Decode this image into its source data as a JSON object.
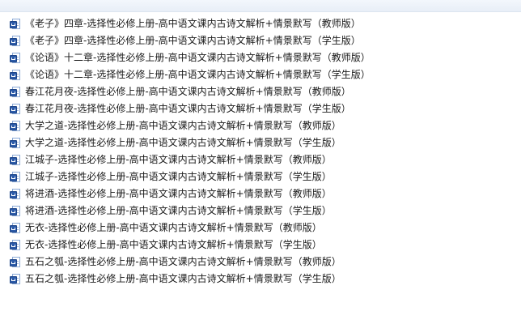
{
  "files": [
    {
      "name": "《老子》四章-选择性必修上册-高中语文课内古诗文解析+情景默写（教师版）",
      "icon": "word-doc-icon"
    },
    {
      "name": "《老子》四章-选择性必修上册-高中语文课内古诗文解析+情景默写（学生版）",
      "icon": "word-doc-icon"
    },
    {
      "name": "《论语》十二章-选择性必修上册-高中语文课内古诗文解析+情景默写（教师版）",
      "icon": "word-doc-icon"
    },
    {
      "name": "《论语》十二章-选择性必修上册-高中语文课内古诗文解析+情景默写（学生版）",
      "icon": "word-doc-icon"
    },
    {
      "name": "春江花月夜-选择性必修上册-高中语文课内古诗文解析+情景默写（教师版）",
      "icon": "word-doc-icon"
    },
    {
      "name": "春江花月夜-选择性必修上册-高中语文课内古诗文解析+情景默写（学生版）",
      "icon": "word-doc-icon"
    },
    {
      "name": "大学之道-选择性必修上册-高中语文课内古诗文解析+情景默写（教师版）",
      "icon": "word-doc-icon"
    },
    {
      "name": "大学之道-选择性必修上册-高中语文课内古诗文解析+情景默写（学生版）",
      "icon": "word-doc-icon"
    },
    {
      "name": "江城子-选择性必修上册-高中语文课内古诗文解析+情景默写（教师版）",
      "icon": "word-doc-icon"
    },
    {
      "name": "江城子-选择性必修上册-高中语文课内古诗文解析+情景默写（学生版）",
      "icon": "word-doc-icon"
    },
    {
      "name": "将进酒-选择性必修上册-高中语文课内古诗文解析+情景默写（教师版）",
      "icon": "word-doc-icon"
    },
    {
      "name": "将进酒-选择性必修上册-高中语文课内古诗文解析+情景默写（学生版）",
      "icon": "word-doc-icon"
    },
    {
      "name": "无衣-选择性必修上册-高中语文课内古诗文解析+情景默写（教师版）",
      "icon": "word-doc-icon"
    },
    {
      "name": "无衣-选择性必修上册-高中语文课内古诗文解析+情景默写（学生版）",
      "icon": "word-doc-icon"
    },
    {
      "name": "五石之瓠-选择性必修上册-高中语文课内古诗文解析+情景默写（教师版）",
      "icon": "word-doc-icon"
    },
    {
      "name": "五石之瓠-选择性必修上册-高中语文课内古诗文解析+情景默写（学生版）",
      "icon": "word-doc-icon"
    }
  ]
}
